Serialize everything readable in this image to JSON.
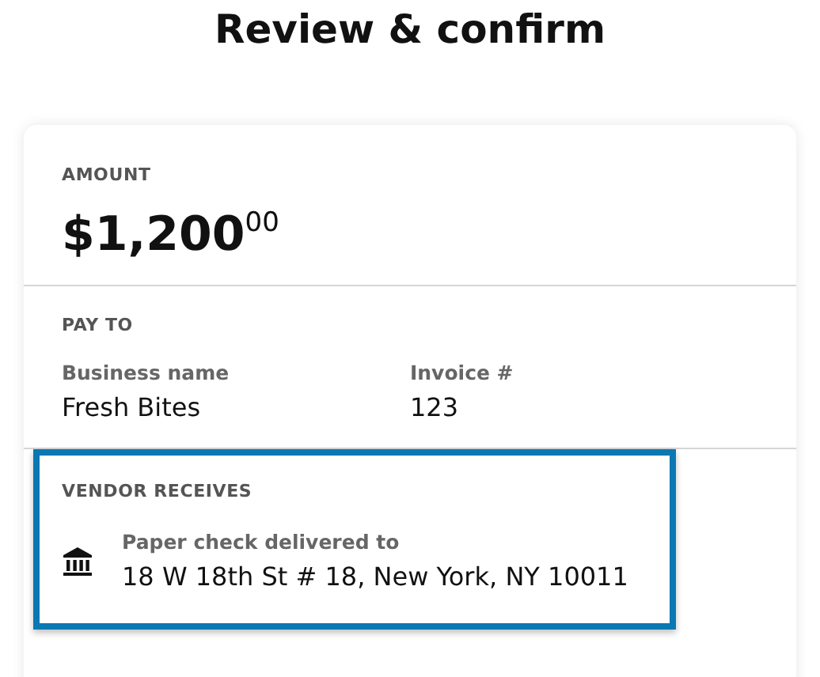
{
  "title": "Review & confirm",
  "amount": {
    "label": "AMOUNT",
    "value": "$1,200$^{00}$"
  },
  "pay_to": {
    "label": "PAY TO",
    "fields": [
      {
        "label": "Business name",
        "value": "Fresh Bites"
      },
      {
        "label": "Invoice #",
        "value": "123"
      }
    ]
  },
  "vendor_receives": {
    "label": "VENDOR RECEIVES",
    "highlighted": true,
    "method": "Paper check delivered to",
    "address": "18 W 18th St # 18, New York, NY 10011"
  }
}
